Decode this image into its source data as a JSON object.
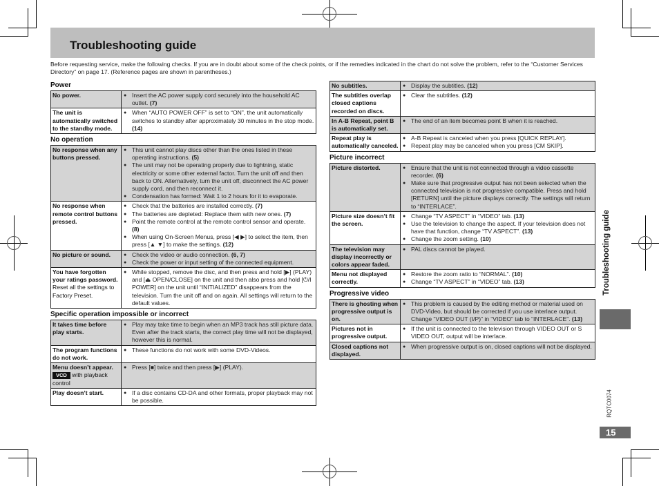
{
  "title": "Troubleshooting guide",
  "intro": "Before requesting service, make the following checks. If you are in doubt about some of the check points, or if the remedies indicated in the chart do not solve the problem, refer to the “Customer Services Directory” on page 17. (Reference pages are shown in parentheses.)",
  "side_tab": "Troubleshooting guide",
  "doc_code": "RQTC0074",
  "page_number": "15",
  "sections": {
    "power": {
      "title": "Power",
      "rows": [
        {
          "problem": "No power.",
          "items": [
            {
              "text": "Insert the AC power supply cord securely into the household AC outlet.",
              "ref": "(7)"
            }
          ]
        },
        {
          "problem": "The unit is automatically switched to the standby mode.",
          "items": [
            {
              "text": "When “AUTO POWER OFF” is set to “ON”, the unit automatically switches to standby after approximately 30 minutes in the stop mode.",
              "ref": "(14)"
            }
          ]
        }
      ]
    },
    "no_operation": {
      "title": "No operation",
      "rows": [
        {
          "problem": "No response when any buttons pressed.",
          "items": [
            {
              "text": "This unit cannot play discs other than the ones listed in these operating instructions.",
              "ref": "(5)"
            },
            {
              "text": "The unit may not be operating properly due to lightning, static electricity or some other external factor. Turn the unit off and then back to ON. Alternatively, turn the unit off, disconnect the AC power supply cord, and then reconnect it.",
              "ref": ""
            },
            {
              "text": "Condensation has formed: Wait 1 to 2 hours for it to evaporate.",
              "ref": ""
            }
          ]
        },
        {
          "problem": "No response when remote control buttons pressed.",
          "items": [
            {
              "text": "Check that the batteries are installed correctly.",
              "ref": "(7)"
            },
            {
              "text": "The batteries are depleted: Replace them with new ones.",
              "ref": "(7)"
            },
            {
              "text": "Point the remote control at the remote control sensor and operate.",
              "ref": "(8)"
            },
            {
              "text": "When using On-Screen Menus, press [◀ ▶] to select the item, then press [▲ ▼] to make the settings.",
              "ref": "(12)"
            }
          ]
        },
        {
          "problem": "No picture or sound.",
          "items": [
            {
              "text": "Check the video or audio connection.",
              "ref": "(6, 7)"
            },
            {
              "text": "Check the power or input setting of the connected equipment.",
              "ref": ""
            }
          ]
        },
        {
          "problem": "You have forgotten your ratings password.",
          "problem_sub": "Reset all the settings to Factory Preset.",
          "items": [
            {
              "text": "While stopped, remove the disc, and then press and hold [▶] (PLAY) and [⏏ OPEN/CLOSE] on the unit and then also press and hold [⏻/I POWER] on the unit until “INITIALIZED” disappears from the television. Turn the unit off and on again. All settings will return to the default values.",
              "ref": ""
            }
          ]
        }
      ]
    },
    "specific": {
      "title": "Specific operation impossible or incorrect",
      "rows": [
        {
          "problem": "It takes time before play starts.",
          "items": [
            {
              "text": "Play may take time to begin when an MP3 track has still picture data. Even after the track starts, the correct play time will not be displayed, however this is normal.",
              "ref": ""
            }
          ]
        },
        {
          "problem": "The program functions do not work.",
          "items": [
            {
              "text": "These functions do not work with some DVD-Videos.",
              "ref": ""
            }
          ]
        },
        {
          "problem": "Menu doesn’t appear.",
          "badge": "VCD",
          "problem_tail": " with playback control",
          "items": [
            {
              "text": "Press [■] twice and then press [▶] (PLAY).",
              "ref": ""
            }
          ]
        },
        {
          "problem": "Play doesn’t start.",
          "items": [
            {
              "text": "If a disc contains CD-DA and other formats, proper playback may not be possible.",
              "ref": ""
            }
          ]
        }
      ]
    },
    "subtitles": {
      "rows": [
        {
          "problem": "No subtitles.",
          "items": [
            {
              "text": "Display the subtitles.",
              "ref": "(12)"
            }
          ]
        },
        {
          "problem": "The subtitles overlap closed captions recorded on discs.",
          "items": [
            {
              "text": "Clear the subtitles.",
              "ref": "(12)"
            }
          ]
        },
        {
          "problem": "In A-B Repeat, point B is automatically set.",
          "items": [
            {
              "text": "The end of an item becomes point B when it is reached.",
              "ref": ""
            }
          ]
        },
        {
          "problem": "Repeat play is automatically canceled.",
          "items": [
            {
              "text": "A-B Repeat is canceled when you press [QUICK REPLAY].",
              "ref": ""
            },
            {
              "text": "Repeat play may be canceled when you press [CM SKIP].",
              "ref": ""
            }
          ]
        }
      ]
    },
    "picture": {
      "title": "Picture incorrect",
      "rows": [
        {
          "problem": "Picture distorted.",
          "items": [
            {
              "text": "Ensure that the unit is not connected through a video cassette recorder.",
              "ref": "(6)"
            },
            {
              "text": "Make sure that progressive output has not been selected when the connected television is not progressive compatible. Press and hold [RETURN] until the picture displays correctly. The settings will return to “INTERLACE”.",
              "ref": ""
            }
          ]
        },
        {
          "problem": "Picture size doesn’t fit the screen.",
          "items": [
            {
              "text": "Change “TV ASPECT” in “VIDEO” tab.",
              "ref": "(13)"
            },
            {
              "text": "Use the television to change the aspect. If your television does not have that function, change “TV ASPECT”.",
              "ref": "(13)"
            },
            {
              "text": "Change the zoom setting.",
              "ref": "(10)"
            }
          ]
        },
        {
          "problem": "The television may display incorrectly or colors appear faded.",
          "items": [
            {
              "text": "PAL discs cannot be played.",
              "ref": ""
            }
          ]
        },
        {
          "problem": "Menu not displayed correctly.",
          "items": [
            {
              "text": "Restore the zoom ratio to “NORMAL”.",
              "ref": "(10)"
            },
            {
              "text": "Change “TV ASPECT” in “VIDEO” tab.",
              "ref": "(13)"
            }
          ]
        }
      ]
    },
    "progressive": {
      "title": "Progressive video",
      "rows": [
        {
          "problem": "There is ghosting when progressive output is on.",
          "items": [
            {
              "text": "This problem is caused by the editing method or material used on DVD-Video, but should be corrected if you use interlace output. Change “VIDEO OUT (I/P)” in “VIDEO” tab to “INTERLACE”.",
              "ref": "(13)"
            }
          ]
        },
        {
          "problem": "Pictures not in progressive output.",
          "items": [
            {
              "text": "If the unit is connected to the television through VIDEO OUT or S VIDEO OUT, output will be interlace.",
              "ref": ""
            }
          ]
        },
        {
          "problem": "Closed captions not displayed.",
          "items": [
            {
              "text": "When progressive output is on, closed captions will not be displayed.",
              "ref": ""
            }
          ]
        }
      ]
    }
  }
}
